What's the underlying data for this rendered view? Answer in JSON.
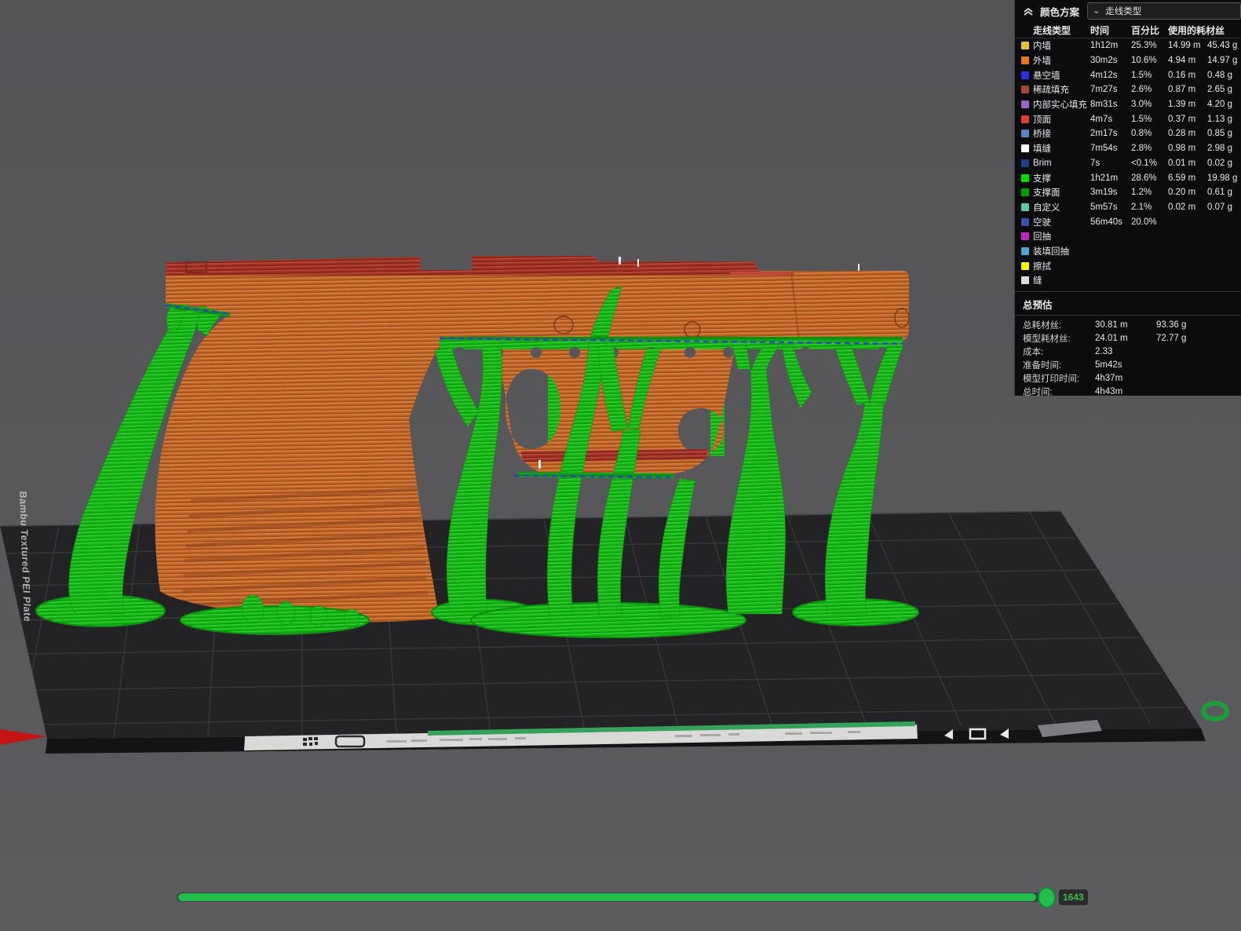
{
  "panel": {
    "title": "颜色方案",
    "view_selector": {
      "value": "走线类型"
    },
    "columns": [
      "走线类型",
      "时间",
      "百分比",
      "使用的耗材丝"
    ],
    "rows": [
      {
        "label": "内墙",
        "color": "#E6C229",
        "time": "1h12m",
        "pct": "25.3%",
        "len": "14.99 m",
        "wt": "45.43 g"
      },
      {
        "label": "外墙",
        "color": "#E8771F",
        "time": "30m2s",
        "pct": "10.6%",
        "len": "4.94 m",
        "wt": "14.97 g"
      },
      {
        "label": "悬空墙",
        "color": "#2B2BE8",
        "time": "4m12s",
        "pct": "1.5%",
        "len": "0.16 m",
        "wt": "0.48 g"
      },
      {
        "label": "稀疏填充",
        "color": "#A64436",
        "time": "7m27s",
        "pct": "2.6%",
        "len": "0.87 m",
        "wt": "2.65 g"
      },
      {
        "label": "内部实心填充",
        "color": "#9763C8",
        "time": "8m31s",
        "pct": "3.0%",
        "len": "1.39 m",
        "wt": "4.20 g"
      },
      {
        "label": "顶面",
        "color": "#E23C35",
        "time": "4m7s",
        "pct": "1.5%",
        "len": "0.37 m",
        "wt": "1.13 g"
      },
      {
        "label": "桥接",
        "color": "#5A7FC3",
        "time": "2m17s",
        "pct": "0.8%",
        "len": "0.28 m",
        "wt": "0.85 g"
      },
      {
        "label": "填缝",
        "color": "#FFFFFF",
        "time": "7m54s",
        "pct": "2.8%",
        "len": "0.98 m",
        "wt": "2.98 g"
      },
      {
        "label": "Brim",
        "color": "#1C3F86",
        "time": "7s",
        "pct": "<0.1%",
        "len": "0.01 m",
        "wt": "0.02 g"
      },
      {
        "label": "支撑",
        "color": "#00E000",
        "time": "1h21m",
        "pct": "28.6%",
        "len": "6.59 m",
        "wt": "19.98 g"
      },
      {
        "label": "支撑面",
        "color": "#00A000",
        "time": "3m19s",
        "pct": "1.2%",
        "len": "0.20 m",
        "wt": "0.61 g"
      },
      {
        "label": "自定义",
        "color": "#5EC9A1",
        "time": "5m57s",
        "pct": "2.1%",
        "len": "0.02 m",
        "wt": "0.07 g"
      },
      {
        "label": "空驶",
        "color": "#3E4FA8",
        "time": "56m40s",
        "pct": "20.0%",
        "len": "",
        "wt": ""
      },
      {
        "label": "回抽",
        "color": "#C327C3",
        "time": "",
        "pct": "",
        "len": "",
        "wt": ""
      },
      {
        "label": "装填回抽",
        "color": "#4FA4CF",
        "time": "",
        "pct": "",
        "len": "",
        "wt": ""
      },
      {
        "label": "擦拭",
        "color": "#F5F500",
        "time": "",
        "pct": "",
        "len": "",
        "wt": ""
      },
      {
        "label": "缝",
        "color": "#DCDCDC",
        "time": "",
        "pct": "",
        "len": "",
        "wt": ""
      }
    ],
    "totals": {
      "title": "总预估",
      "rows": [
        {
          "label": "总耗材丝:",
          "v1": "30.81 m",
          "v2": "93.36 g"
        },
        {
          "label": "模型耗材丝:",
          "v1": "24.01 m",
          "v2": "72.77 g"
        },
        {
          "label": "成本:",
          "v1": "2.33",
          "v2": ""
        },
        {
          "label": "准备时间:",
          "v1": "5m42s",
          "v2": ""
        },
        {
          "label": "模型打印时间:",
          "v1": "4h37m",
          "v2": ""
        },
        {
          "label": "总时间:",
          "v1": "4h43m",
          "v2": ""
        }
      ]
    }
  },
  "viewport": {
    "plate_label": "Bambu Textured PEI Plate",
    "layer_slider": {
      "value": "1643"
    }
  },
  "colors": {
    "panel_bg": "#0C0C0E",
    "model_orange": "#BE6526",
    "model_orange_light": "#D97E3E",
    "model_orange_dark": "#8F451A",
    "top_red": "#9E3126",
    "top_red_light": "#BE4836",
    "top_red_dark": "#6E1F16",
    "support_green": "#14B414",
    "support_green_light": "#2FD32F",
    "support_green_dark": "#0B8E0E",
    "interface_green": "#0A9110",
    "interface_green_light": "#17AC1E",
    "overhang_blue": "#3A3AD8",
    "slider_green": "#22BD4A",
    "label_green": "#3DBE4B",
    "axis_red": "#C41414",
    "plate_accent_green": "#35A159",
    "ring_green": "#1B9E38"
  }
}
